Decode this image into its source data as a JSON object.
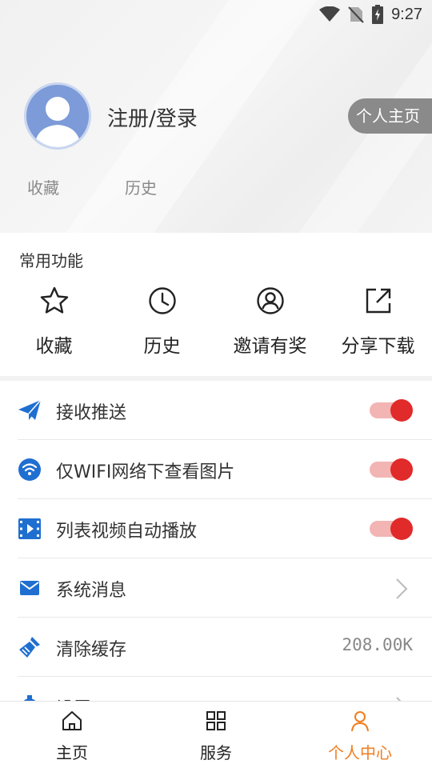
{
  "status_bar": {
    "time": "9:27",
    "icons": [
      "wifi-icon",
      "no-sim-icon",
      "battery-charging-icon"
    ]
  },
  "profile": {
    "login_label": "注册/登录",
    "homepage_button": "个人主页",
    "quick_links": [
      "收藏",
      "历史"
    ]
  },
  "features": {
    "section_title": "常用功能",
    "items": [
      {
        "label": "收藏",
        "icon": "star-icon"
      },
      {
        "label": "历史",
        "icon": "clock-icon"
      },
      {
        "label": "邀请有奖",
        "icon": "user-circle-icon"
      },
      {
        "label": "分享下载",
        "icon": "share-icon"
      }
    ]
  },
  "settings": {
    "rows": [
      {
        "label": "接收推送",
        "icon": "paper-plane-icon",
        "type": "toggle",
        "on": true
      },
      {
        "label": "仅WIFI网络下查看图片",
        "icon": "wifi-circle-icon",
        "type": "toggle",
        "on": true
      },
      {
        "label": "列表视频自动播放",
        "icon": "video-icon",
        "type": "toggle",
        "on": true
      },
      {
        "label": "系统消息",
        "icon": "mail-icon",
        "type": "chevron"
      },
      {
        "label": "清除缓存",
        "icon": "broom-icon",
        "type": "value",
        "value": "208.00K"
      },
      {
        "label": "设置",
        "icon": "gear-icon",
        "type": "chevron"
      }
    ]
  },
  "bottom_nav": {
    "items": [
      {
        "label": "主页",
        "icon": "home-icon",
        "active": false
      },
      {
        "label": "服务",
        "icon": "grid-icon",
        "active": false
      },
      {
        "label": "个人中心",
        "icon": "person-icon",
        "active": true
      }
    ]
  },
  "colors": {
    "accent_active": "#f07d1f",
    "toggle_on": "#e12a2a",
    "icon_blue": "#1f6fd1"
  }
}
